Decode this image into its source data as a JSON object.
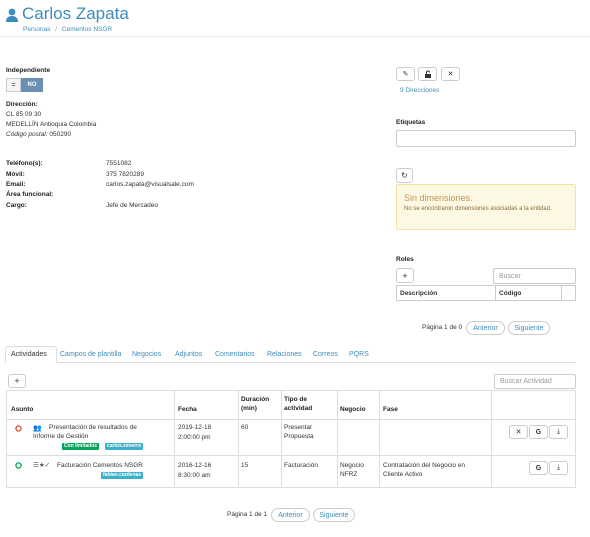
{
  "header": {
    "title": "Carlos Zapata",
    "breadcrumb": [
      "Personas",
      "Cementos NSGR"
    ],
    "breadcrumb_sep": "/"
  },
  "independiente": {
    "label": "Independiente",
    "toggle_on": "=",
    "toggle_off": "NO"
  },
  "address": {
    "label": "Dirección:",
    "line1": "CL 85 09 30",
    "line2": "MEDELLÍN Antioquia Colombia",
    "postal_label": "Código postal:",
    "postal_value": "050290"
  },
  "details": [
    {
      "label": "Teléfono(s):",
      "value": "7551082"
    },
    {
      "label": "Móvil:",
      "value": "375 7820289"
    },
    {
      "label": "Email:",
      "value": "carlos.zapata@visualsale.com"
    },
    {
      "label": "Área funcional:",
      "value": ""
    },
    {
      "label": "Cargo:",
      "value": "Jefe de Mercadeo"
    }
  ],
  "actions": {
    "edit": "✎",
    "lock": "🔓",
    "close": "✕",
    "addresses_link": "9 Direcciones"
  },
  "tags": {
    "label": "Etiquetas",
    "value": ""
  },
  "dimensions": {
    "refresh": "↻",
    "title": "Sin dimensiones.",
    "text": "No se encontraron dimensiones asociadas a la entidad."
  },
  "roles": {
    "label": "Roles",
    "add": "+",
    "search_placeholder": "Buscar",
    "columns": [
      "Descripción",
      "Código"
    ],
    "pagination": "Página 1 de 0",
    "prev": "Anterior",
    "next": "Siguiente"
  },
  "tabs": [
    "Actividades",
    "Campos de plantilla",
    "Negocios",
    "Adjuntos",
    "Comentarios",
    "Relaciones",
    "Correos",
    "PQRS"
  ],
  "activities": {
    "add": "+",
    "search_placeholder": "Buscar Actividad",
    "columns": [
      "Asunto",
      "Fecha",
      "Duración (min)",
      "Tipo de actividad",
      "Negocio",
      "Fase"
    ],
    "rows": [
      {
        "status_color": "#dd4b39",
        "subject": "Presentación de resultados de Informe de Gestión",
        "tags": [
          {
            "text": "Con limitados",
            "color": "#00a65a"
          },
          {
            "text": "carlos.zenerro",
            "color": "#3cb0c8"
          }
        ],
        "date": "2019-12-18",
        "time": "2:00:00 pm",
        "duration": "60",
        "type": "Presentar Propuesta",
        "deal": "",
        "phase": ""
      },
      {
        "status_color": "#00a65a",
        "subject": "Facturación Cementos NSGR",
        "tags": [
          {
            "text": "fabian.cardenas",
            "color": "#3cb0c8"
          }
        ],
        "date": "2016-12-16",
        "time": "8:30:00 am",
        "duration": "15",
        "type": "Facturación",
        "deal": "Negocio NFRZ",
        "phase": "Contratación del Negocio en Cliente Activo"
      }
    ],
    "pagination": "Página 1 de 1",
    "prev": "Anterior",
    "next": "Siguiente"
  },
  "colors": {
    "accent": "#3c8dbc",
    "warning_bg": "#fcf8e3",
    "warning_border": "#f5e3a4",
    "warning_title": "#c09853"
  },
  "icons": [
    "user-icon",
    "edit-icon",
    "unlock-icon",
    "close-icon",
    "refresh-icon",
    "plus-icon",
    "google-icon",
    "download-icon"
  ]
}
